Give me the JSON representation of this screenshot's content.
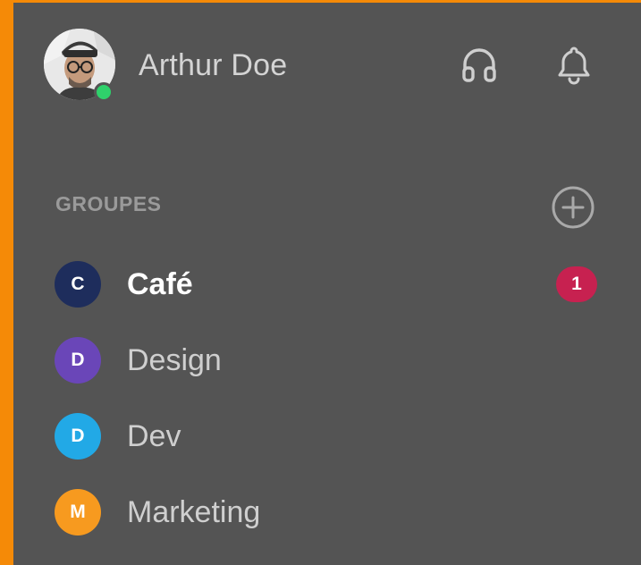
{
  "user": {
    "name": "Arthur Doe",
    "status": "online",
    "status_color": "#2fd16b"
  },
  "header_actions": {
    "headset_icon": "headset-icon",
    "bell_icon": "bell-icon"
  },
  "groups": {
    "title": "GROUPES",
    "add_icon": "add-circle-icon",
    "items": [
      {
        "initial": "C",
        "name": "Café",
        "color": "#1e2d5c",
        "unread": "1",
        "bold": true
      },
      {
        "initial": "D",
        "name": "Design",
        "color": "#6a46b8",
        "unread": null,
        "bold": false
      },
      {
        "initial": "D",
        "name": "Dev",
        "color": "#22a9e6",
        "unread": null,
        "bold": false
      },
      {
        "initial": "M",
        "name": "Marketing",
        "color": "#f79a1f",
        "unread": null,
        "bold": false
      }
    ]
  },
  "colors": {
    "frame_accent": "#f58a07",
    "panel_bg": "#545454",
    "badge": "#c72150"
  }
}
